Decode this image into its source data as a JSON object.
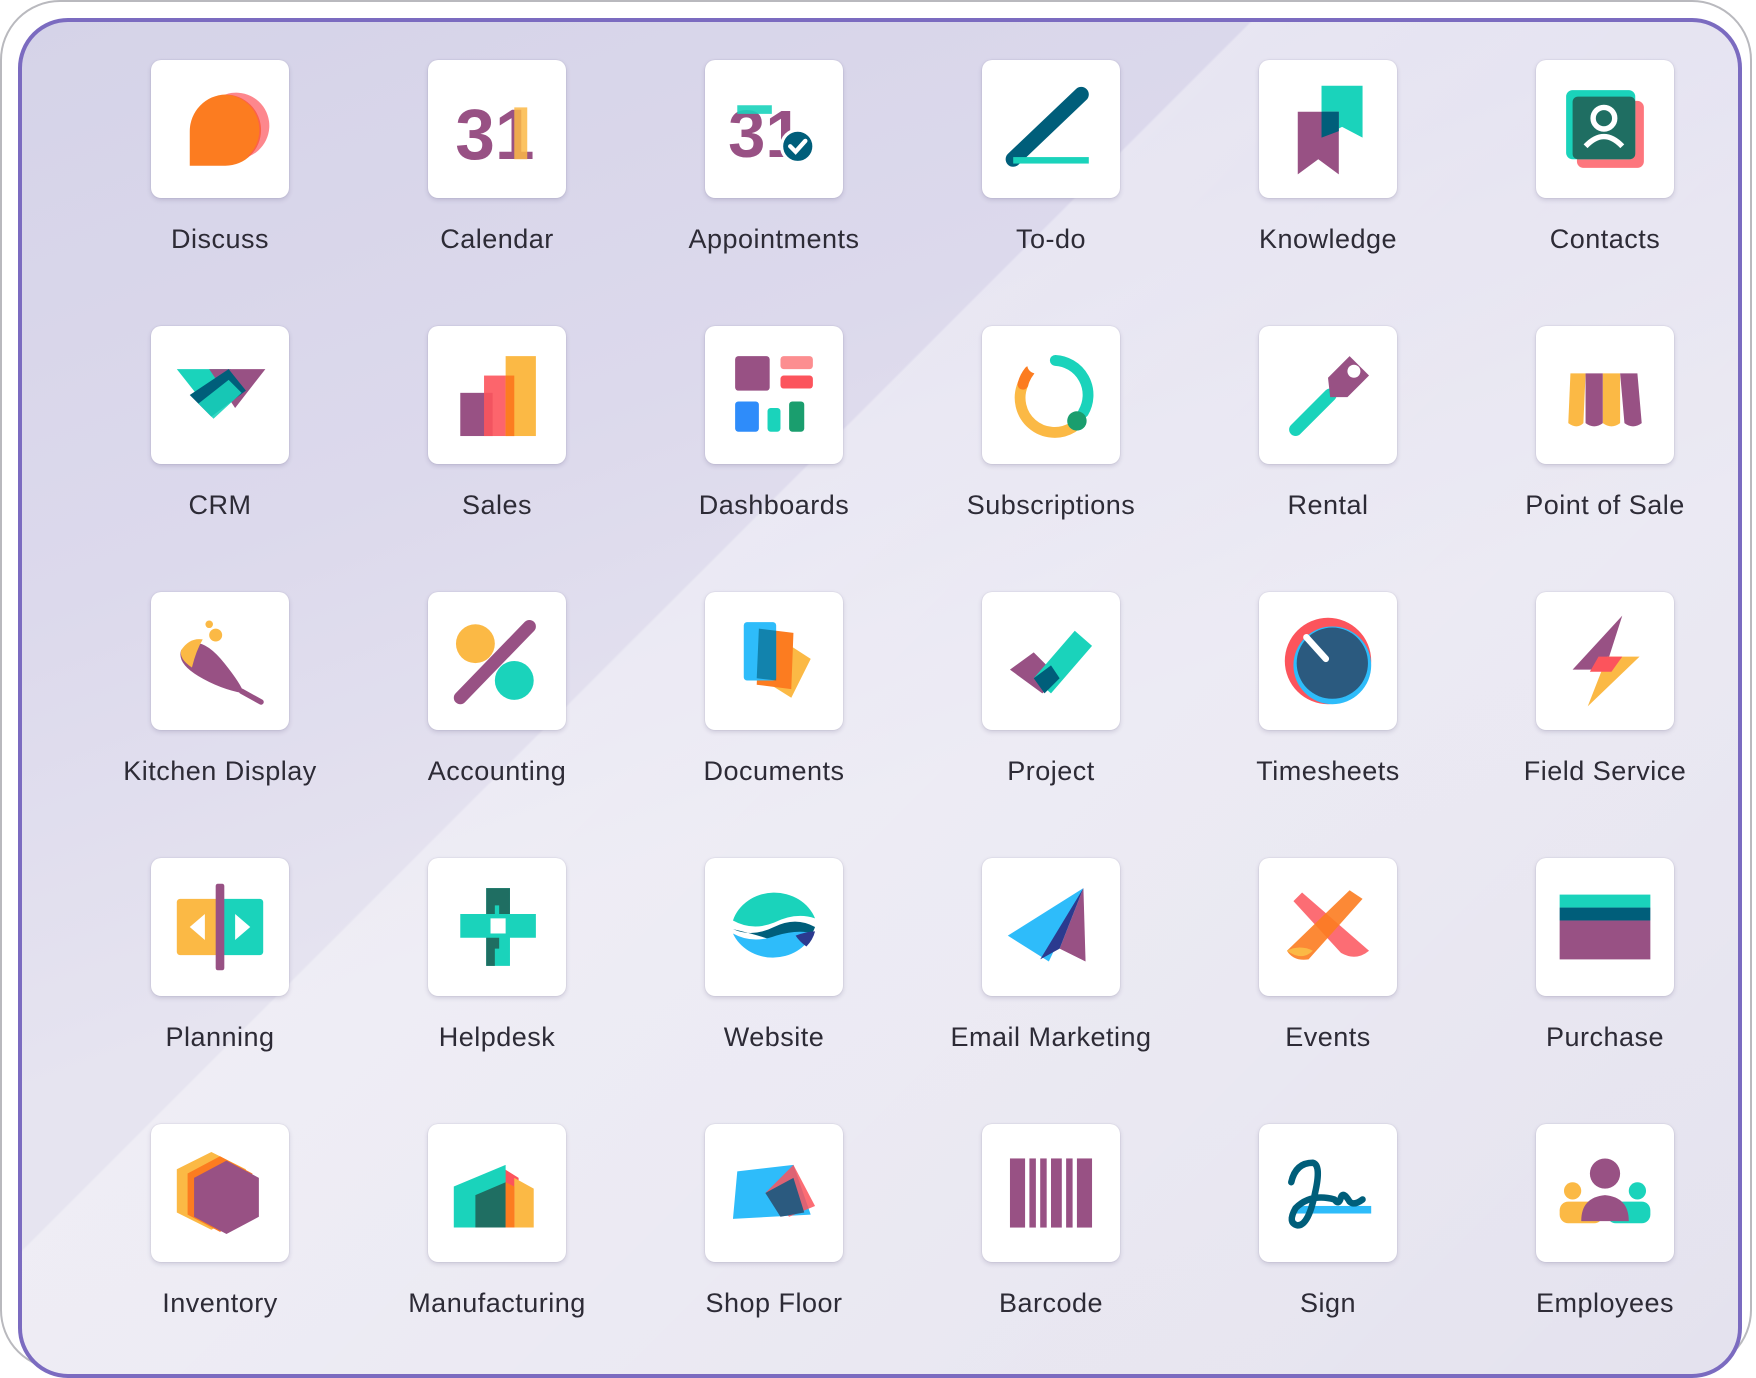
{
  "apps": [
    {
      "label": "Discuss",
      "icon": "discuss-icon"
    },
    {
      "label": "Calendar",
      "icon": "calendar-icon"
    },
    {
      "label": "Appointments",
      "icon": "appointments-icon"
    },
    {
      "label": "To-do",
      "icon": "todo-icon"
    },
    {
      "label": "Knowledge",
      "icon": "knowledge-icon"
    },
    {
      "label": "Contacts",
      "icon": "contacts-icon"
    },
    {
      "label": "CRM",
      "icon": "crm-icon"
    },
    {
      "label": "Sales",
      "icon": "sales-icon"
    },
    {
      "label": "Dashboards",
      "icon": "dashboards-icon"
    },
    {
      "label": "Subscriptions",
      "icon": "subscriptions-icon"
    },
    {
      "label": "Rental",
      "icon": "rental-icon"
    },
    {
      "label": "Point of Sale",
      "icon": "point-of-sale-icon"
    },
    {
      "label": "Kitchen Display",
      "icon": "kitchen-display-icon"
    },
    {
      "label": "Accounting",
      "icon": "accounting-icon"
    },
    {
      "label": "Documents",
      "icon": "documents-icon"
    },
    {
      "label": "Project",
      "icon": "project-icon"
    },
    {
      "label": "Timesheets",
      "icon": "timesheets-icon"
    },
    {
      "label": "Field Service",
      "icon": "field-service-icon"
    },
    {
      "label": "Planning",
      "icon": "planning-icon"
    },
    {
      "label": "Helpdesk",
      "icon": "helpdesk-icon"
    },
    {
      "label": "Website",
      "icon": "website-icon"
    },
    {
      "label": "Email Marketing",
      "icon": "email-marketing-icon"
    },
    {
      "label": "Events",
      "icon": "events-icon"
    },
    {
      "label": "Purchase",
      "icon": "purchase-icon"
    },
    {
      "label": "Inventory",
      "icon": "inventory-icon"
    },
    {
      "label": "Manufacturing",
      "icon": "manufacturing-icon"
    },
    {
      "label": "Shop Floor",
      "icon": "shop-floor-icon"
    },
    {
      "label": "Barcode",
      "icon": "barcode-icon"
    },
    {
      "label": "Sign",
      "icon": "sign-icon"
    },
    {
      "label": "Employees",
      "icon": "employees-icon"
    }
  ],
  "colors": {
    "panel_border": "#7b6bc0",
    "label_text": "#2d2b36",
    "purple": "#985184",
    "teal": "#1ad3bb",
    "dark_teal": "#005e7a",
    "orange": "#fc7c20",
    "yellow": "#fbb945",
    "red": "#fc545c",
    "blue": "#2ebcfa"
  },
  "icon_numbers": {
    "calendar_day": "31",
    "appointments_day": "31"
  }
}
